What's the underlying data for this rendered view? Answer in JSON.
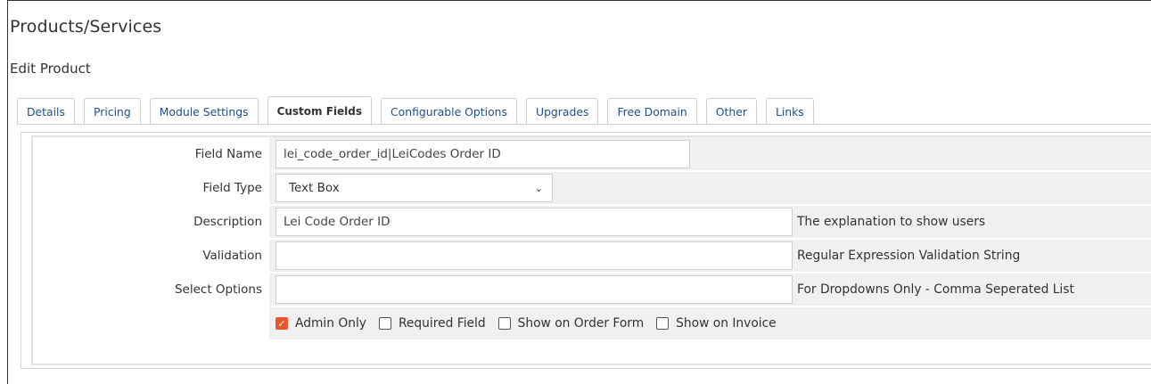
{
  "page": {
    "title": "Products/Services",
    "subtitle": "Edit Product"
  },
  "tabs": [
    {
      "label": "Details",
      "active": false
    },
    {
      "label": "Pricing",
      "active": false
    },
    {
      "label": "Module Settings",
      "active": false
    },
    {
      "label": "Custom Fields",
      "active": true
    },
    {
      "label": "Configurable Options",
      "active": false
    },
    {
      "label": "Upgrades",
      "active": false
    },
    {
      "label": "Free Domain",
      "active": false
    },
    {
      "label": "Other",
      "active": false
    },
    {
      "label": "Links",
      "active": false
    }
  ],
  "form": {
    "field_name": {
      "label": "Field Name",
      "value": "lei_code_order_id|LeiCodes Order ID"
    },
    "field_type": {
      "label": "Field Type",
      "value": "Text Box",
      "icon": "chevron-down-icon"
    },
    "description": {
      "label": "Description",
      "value": "Lei Code Order ID",
      "hint": "The explanation to show users"
    },
    "validation": {
      "label": "Validation",
      "value": "",
      "hint": "Regular Expression Validation String"
    },
    "select_options": {
      "label": "Select Options",
      "value": "",
      "hint": "For Dropdowns Only - Comma Seperated List"
    },
    "checkboxes": [
      {
        "label": "Admin Only",
        "checked": true
      },
      {
        "label": "Required Field",
        "checked": false
      },
      {
        "label": "Show on Order Form",
        "checked": false
      },
      {
        "label": "Show on Invoice",
        "checked": false
      }
    ]
  },
  "colors": {
    "accent": "#e8562a",
    "link": "#1f4f8a",
    "row_bg": "#f0f0f0"
  }
}
